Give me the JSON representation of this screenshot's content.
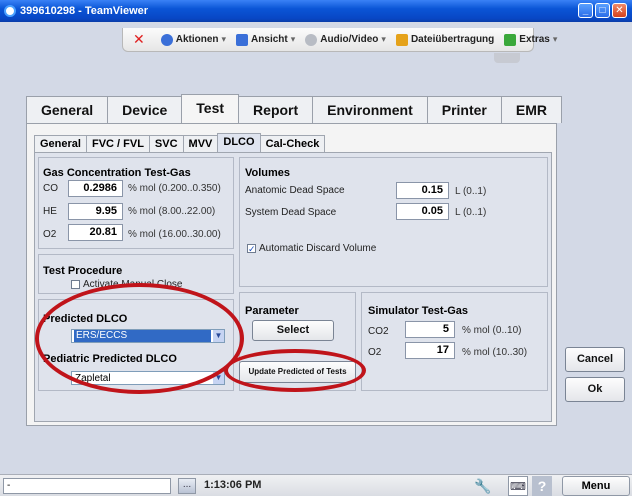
{
  "window": {
    "title": "399610298 - TeamViewer",
    "minimize": "_",
    "maximize": "□",
    "close": "✕"
  },
  "tv_toolbar": {
    "close": "✕",
    "items": [
      {
        "label": "Aktionen",
        "icon": "actions-icon",
        "color": "#3a6fd8"
      },
      {
        "label": "Ansicht",
        "icon": "view-icon",
        "color": "#3a6fd8"
      },
      {
        "label": "Audio/Video",
        "icon": "audio-video-icon",
        "color": "#9aa0aa"
      },
      {
        "label": "Dateiübertragung",
        "icon": "file-transfer-icon",
        "color": "#e5a21a"
      },
      {
        "label": "Extras",
        "icon": "extras-icon",
        "color": "#3aa83a"
      }
    ],
    "caret": "▾"
  },
  "main_tabs": [
    "General",
    "Device",
    "Test",
    "Report",
    "Environment",
    "Printer",
    "EMR"
  ],
  "main_tab_active": "Test",
  "sub_tabs": [
    "General",
    "FVC / FVL",
    "SVC",
    "MVV",
    "DLCO",
    "Cal-Check"
  ],
  "sub_tab_active": "DLCO",
  "gas_concentration": {
    "title": "Gas Concentration Test-Gas",
    "rows": [
      {
        "label": "CO",
        "value": "0.2986",
        "unit": "% mol (0.200..0.350)"
      },
      {
        "label": "HE",
        "value": "9.95",
        "unit": "% mol (8.00..22.00)"
      },
      {
        "label": "O2",
        "value": "20.81",
        "unit": "% mol (16.00..30.00)"
      }
    ]
  },
  "volumes": {
    "title": "Volumes",
    "rows": [
      {
        "label": "Anatomic Dead Space",
        "value": "0.15",
        "unit": "L (0..1)"
      },
      {
        "label": "System Dead Space",
        "value": "0.05",
        "unit": "L (0..1)"
      }
    ],
    "auto_discard_label": "Automatic Discard Volume",
    "auto_discard_checked": true
  },
  "test_procedure": {
    "title": "Test Procedure",
    "manual_close_label": "Activate Manual Close",
    "manual_close_checked": false
  },
  "predicted": {
    "title": "Predicted DLCO",
    "value": "ERS/ECCS",
    "pediatric_title": "Pediatric Predicted DLCO",
    "pediatric_value": "Zapletal"
  },
  "parameter": {
    "title": "Parameter",
    "select_label": "Select",
    "update_label": "Update Predicted of Tests"
  },
  "simulator": {
    "title": "Simulator Test-Gas",
    "rows": [
      {
        "label": "CO2",
        "value": "5",
        "unit": "% mol (0..10)"
      },
      {
        "label": "O2",
        "value": "17",
        "unit": "% mol (10..30)"
      }
    ]
  },
  "dialog_buttons": {
    "cancel": "Cancel",
    "ok": "Ok"
  },
  "statusbar": {
    "field": "-",
    "dots": "...",
    "time": "1:13:06 PM",
    "menu": "Menu"
  },
  "colors": {
    "annotation_red": "#c0141a",
    "selection_blue": "#316ac5"
  }
}
